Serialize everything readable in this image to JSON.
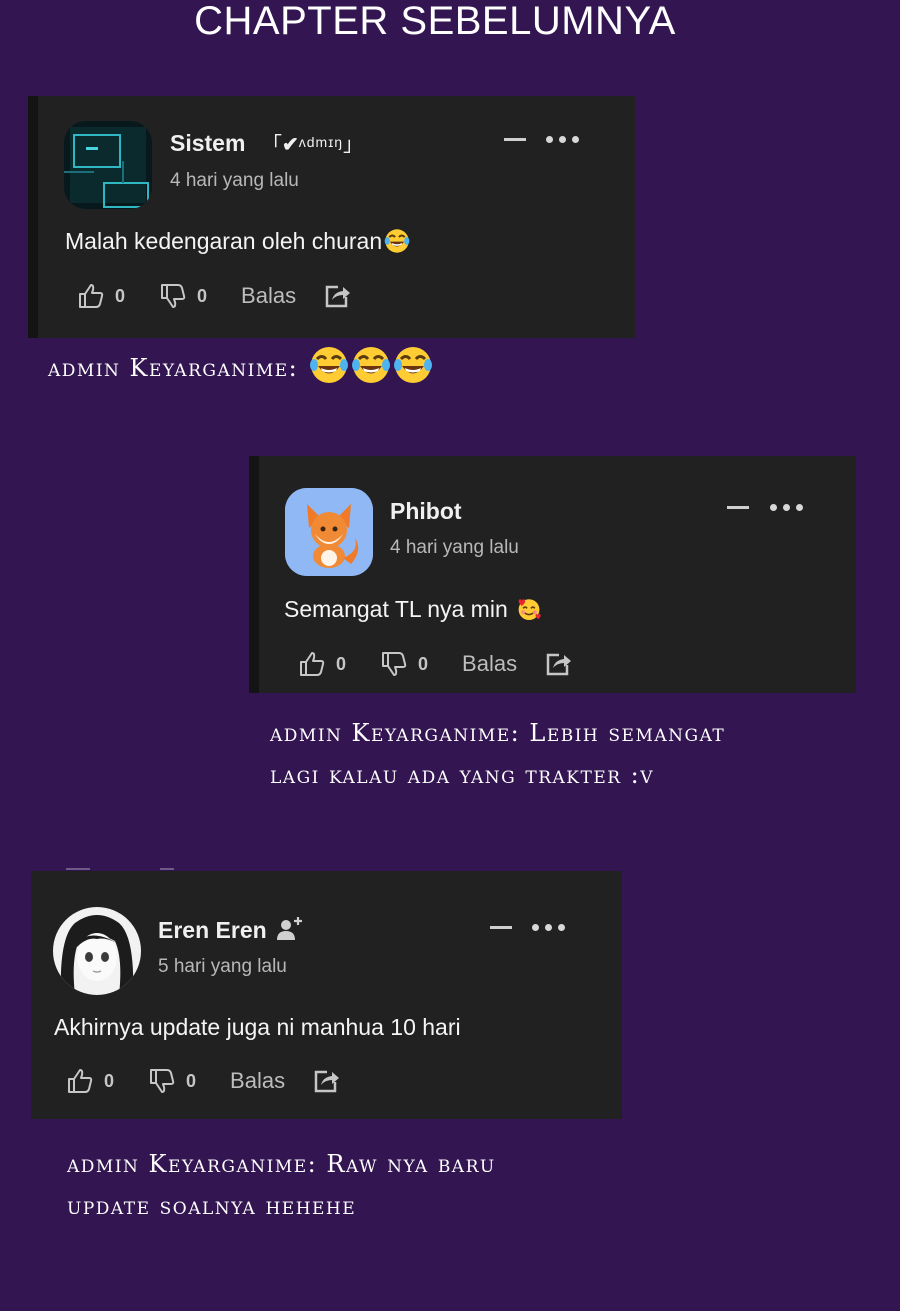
{
  "header": {
    "title": "CHAPTER SEBELUMNYA"
  },
  "colors": {
    "background": "#331552",
    "card": "#212121",
    "card_accent": "#141414",
    "text_primary": "#f0f0f0",
    "text_secondary": "#b8b8b8"
  },
  "comments": [
    {
      "user": "Sistem",
      "badge": {
        "open": "「",
        "check": "✔",
        "label": "ᴧdmɪŋ",
        "close": "」"
      },
      "time": "4 hari yang lalu",
      "text": "Malah kedengaran oleh churan",
      "text_emoji": "face-with-tears-of-joy",
      "likes": "0",
      "dislikes": "0",
      "reply_label": "Balas",
      "avatar_icon": "dark-tech-avatar-icon",
      "admin_reply": {
        "prefix": "admin",
        "name": "Keyarganime",
        "message": "",
        "emojis": [
          "face-with-tears-of-joy",
          "face-with-tears-of-joy",
          "face-with-tears-of-joy"
        ]
      }
    },
    {
      "user": "Phibot",
      "time": "4 hari yang lalu",
      "text": "Semangat TL nya min",
      "text_emoji": "smiling-face-with-hearts",
      "likes": "0",
      "dislikes": "0",
      "reply_label": "Balas",
      "avatar_icon": "fox-avatar-icon",
      "admin_reply": {
        "prefix": "admin",
        "name": "Keyarganime",
        "line1": "Lebih semangat",
        "line2": "lagi kalau ada yang trakter :v"
      }
    },
    {
      "user": "Eren Eren",
      "user_icon": "add-user-icon",
      "time": "5 hari yang lalu",
      "text": "Akhirnya update juga ni manhua 10 hari",
      "likes": "0",
      "dislikes": "0",
      "reply_label": "Balas",
      "avatar_icon": "anime-girl-avatar-icon",
      "admin_reply": {
        "prefix": "admin",
        "name": "Keyarganime",
        "line1": "Raw nya baru",
        "line2": "update soalnya hehehe"
      }
    }
  ]
}
